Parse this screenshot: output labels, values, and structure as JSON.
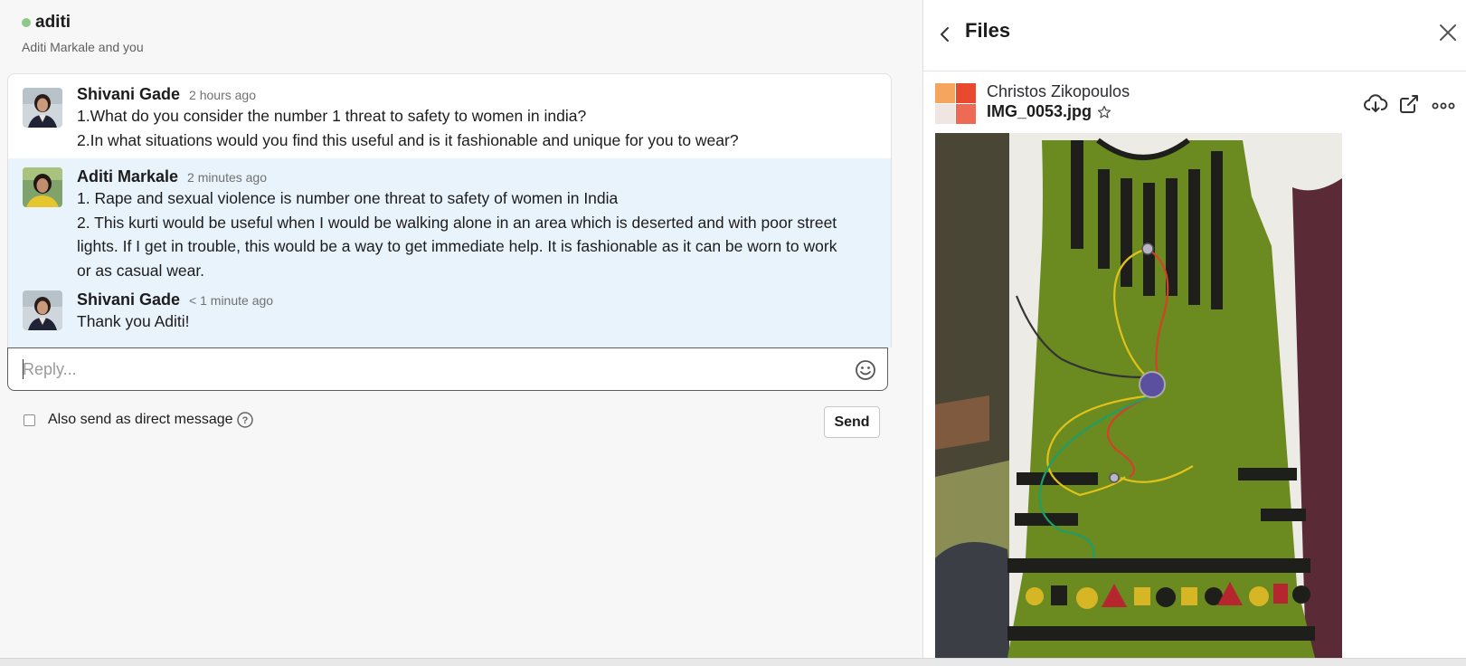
{
  "conversation": {
    "title": "aditi",
    "subtitle": "Aditi Markale and you"
  },
  "messages": [
    {
      "author": "Shivani Gade",
      "timestamp": "2 hours ago",
      "lines": [
        "1.What do you consider the number 1 threat to safety to women in india?",
        "2.In what situations would you find this useful and is it fashionable and unique for you to wear?"
      ]
    },
    {
      "author": "Aditi Markale",
      "timestamp": "2 minutes ago",
      "lines": [
        "1. Rape and sexual violence is number one threat to safety of women in India",
        "2. This kurti would be useful when I would be walking alone in an area which is deserted and with poor street lights. If I get in trouble, this would be a way to get immediate help. It is fashionable as it can be worn to work or as casual wear."
      ]
    },
    {
      "author": "Shivani Gade",
      "timestamp": "< 1 minute ago",
      "lines": [
        "Thank you Aditi!"
      ]
    }
  ],
  "reply": {
    "placeholder": "Reply...",
    "value": ""
  },
  "options": {
    "also_send_label": "Also send as direct message",
    "also_send_checked": false
  },
  "send_label": "Send",
  "files_panel": {
    "title": "Files",
    "owner": "Christos Zikopoulos",
    "file_name": "IMG_0053.jpg"
  },
  "icons": {
    "back": "chevron-left-icon",
    "close": "close-icon",
    "emoji": "smiley-icon",
    "help": "question-circle-icon",
    "star": "star-icon",
    "download": "cloud-download-icon",
    "open": "external-link-icon",
    "more": "more-horizontal-icon"
  },
  "colors": {
    "presence": "#8fc98a",
    "highlight": "#e8f3fb"
  }
}
